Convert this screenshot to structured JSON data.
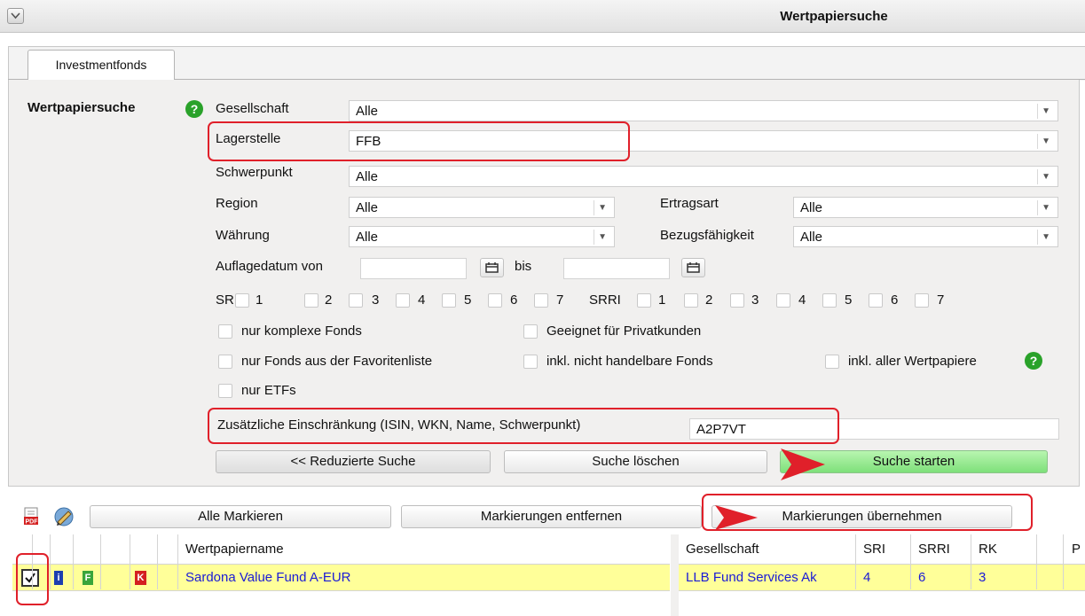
{
  "window": {
    "title": "Wertpapiersuche"
  },
  "tabs": [
    {
      "label": "Investmentfonds"
    }
  ],
  "search": {
    "section_label": "Wertpapiersuche",
    "fields": {
      "gesellschaft": {
        "label": "Gesellschaft",
        "value": "Alle"
      },
      "lagerstelle": {
        "label": "Lagerstelle",
        "value": "FFB"
      },
      "schwerpunkt": {
        "label": "Schwerpunkt",
        "value": "Alle"
      },
      "region": {
        "label": "Region",
        "value": "Alle"
      },
      "ertragsart": {
        "label": "Ertragsart",
        "value": "Alle"
      },
      "waehrung": {
        "label": "Währung",
        "value": "Alle"
      },
      "bezugsfaehigkeit": {
        "label": "Bezugsfähigkeit",
        "value": "Alle"
      },
      "auflagedatum": {
        "label": "Auflagedatum von",
        "from_value": "",
        "bis_label": "bis",
        "to_value": ""
      }
    },
    "sri": {
      "label": "SRI",
      "options": [
        "1",
        "2",
        "3",
        "4",
        "5",
        "6",
        "7"
      ]
    },
    "srri": {
      "label": "SRRI",
      "options": [
        "1",
        "2",
        "3",
        "4",
        "5",
        "6",
        "7"
      ]
    },
    "checkboxes": {
      "komplexe": "nur komplexe Fonds",
      "privatkunden": "Geeignet für Privatkunden",
      "favoriten": "nur Fonds aus der Favoritenliste",
      "nicht_handelbar": "inkl. nicht handelbare Fonds",
      "alle_wertpapiere": "inkl. aller Wertpapiere",
      "etfs": "nur ETFs"
    },
    "restriction": {
      "label": "Zusätzliche Einschränkung (ISIN, WKN, Name, Schwerpunkt)",
      "value": "A2P7VT"
    },
    "buttons": {
      "reduced": "<< Reduzierte Suche",
      "clear": "Suche löschen",
      "start": "Suche starten"
    }
  },
  "results": {
    "toolbar": {
      "mark_all": "Alle Markieren",
      "unmark": "Markierungen entfernen",
      "apply": "Markierungen übernehmen"
    },
    "columns_left": {
      "name": "Wertpapiername"
    },
    "columns_right": [
      "Gesellschaft",
      "SRI",
      "SRRI",
      "RK",
      "P"
    ],
    "rows": [
      {
        "checked": true,
        "name": "Sardona Value Fund A-EUR",
        "gesellschaft": "LLB Fund Services Ak",
        "sri": "4",
        "srri": "6",
        "rk": "3"
      }
    ]
  },
  "colors": {
    "highlight_row": "#ffff99",
    "callout_red": "#e0202a",
    "start_button": "#7ee07a",
    "help_green": "#2aa22a"
  }
}
